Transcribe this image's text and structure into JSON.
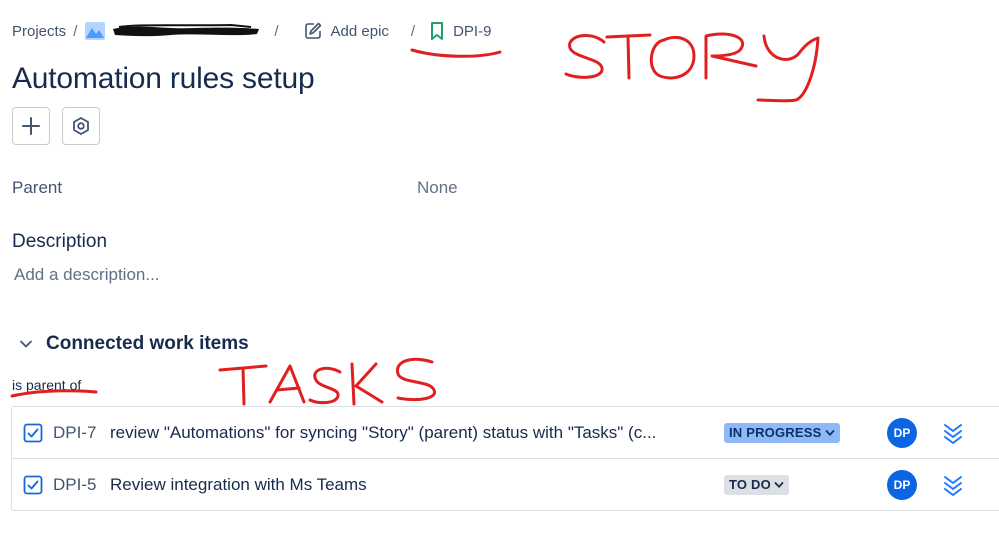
{
  "breadcrumb": {
    "projects_label": "Projects",
    "separator": "/",
    "project_name_redacted": "(redacted project name)",
    "epic_label": "Add epic",
    "issue_key": "DPI-9"
  },
  "page": {
    "title": "Automation rules setup"
  },
  "toolbar": {
    "add_icon": "plus-icon",
    "settings_icon": "hexagon-gear-icon"
  },
  "fields": {
    "parent_label": "Parent",
    "parent_value": "None"
  },
  "description": {
    "heading": "Description",
    "placeholder": "Add a description..."
  },
  "connected": {
    "title": "Connected work items",
    "relation_label": "is parent of",
    "items": [
      {
        "key": "DPI-7",
        "summary": "review \"Automations\" for syncing \"Story\" (parent) status with \"Tasks\" (c...",
        "status": "IN PROGRESS",
        "assignee_initials": "DP",
        "priority_icon": "priority-lowest-icon"
      },
      {
        "key": "DPI-5",
        "summary": "Review integration with Ms Teams",
        "status": "TO DO",
        "assignee_initials": "DP",
        "priority_icon": "priority-lowest-icon"
      }
    ]
  },
  "annotations": {
    "story_text": "STORY",
    "tasks_text": "TASKS",
    "color": "#e02020"
  },
  "colors": {
    "status_in_progress_bg": "#8fb8f6",
    "status_todo_bg": "#dcdfe4",
    "avatar_bg": "#0c66e4",
    "checkbox_blue": "#1868db",
    "story_green": "#22a06b"
  }
}
